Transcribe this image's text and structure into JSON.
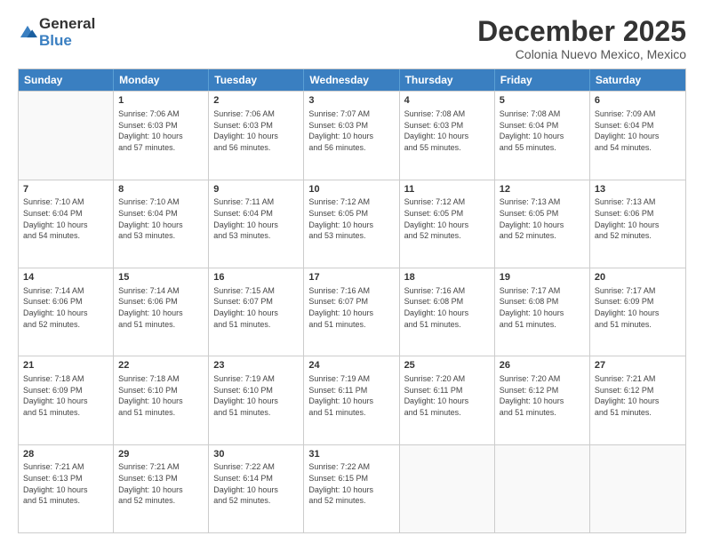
{
  "logo": {
    "general": "General",
    "blue": "Blue"
  },
  "title": "December 2025",
  "subtitle": "Colonia Nuevo Mexico, Mexico",
  "header_days": [
    "Sunday",
    "Monday",
    "Tuesday",
    "Wednesday",
    "Thursday",
    "Friday",
    "Saturday"
  ],
  "weeks": [
    [
      {
        "day": "",
        "info": ""
      },
      {
        "day": "1",
        "info": "Sunrise: 7:06 AM\nSunset: 6:03 PM\nDaylight: 10 hours\nand 57 minutes."
      },
      {
        "day": "2",
        "info": "Sunrise: 7:06 AM\nSunset: 6:03 PM\nDaylight: 10 hours\nand 56 minutes."
      },
      {
        "day": "3",
        "info": "Sunrise: 7:07 AM\nSunset: 6:03 PM\nDaylight: 10 hours\nand 56 minutes."
      },
      {
        "day": "4",
        "info": "Sunrise: 7:08 AM\nSunset: 6:03 PM\nDaylight: 10 hours\nand 55 minutes."
      },
      {
        "day": "5",
        "info": "Sunrise: 7:08 AM\nSunset: 6:04 PM\nDaylight: 10 hours\nand 55 minutes."
      },
      {
        "day": "6",
        "info": "Sunrise: 7:09 AM\nSunset: 6:04 PM\nDaylight: 10 hours\nand 54 minutes."
      }
    ],
    [
      {
        "day": "7",
        "info": "Sunrise: 7:10 AM\nSunset: 6:04 PM\nDaylight: 10 hours\nand 54 minutes."
      },
      {
        "day": "8",
        "info": "Sunrise: 7:10 AM\nSunset: 6:04 PM\nDaylight: 10 hours\nand 53 minutes."
      },
      {
        "day": "9",
        "info": "Sunrise: 7:11 AM\nSunset: 6:04 PM\nDaylight: 10 hours\nand 53 minutes."
      },
      {
        "day": "10",
        "info": "Sunrise: 7:12 AM\nSunset: 6:05 PM\nDaylight: 10 hours\nand 53 minutes."
      },
      {
        "day": "11",
        "info": "Sunrise: 7:12 AM\nSunset: 6:05 PM\nDaylight: 10 hours\nand 52 minutes."
      },
      {
        "day": "12",
        "info": "Sunrise: 7:13 AM\nSunset: 6:05 PM\nDaylight: 10 hours\nand 52 minutes."
      },
      {
        "day": "13",
        "info": "Sunrise: 7:13 AM\nSunset: 6:06 PM\nDaylight: 10 hours\nand 52 minutes."
      }
    ],
    [
      {
        "day": "14",
        "info": "Sunrise: 7:14 AM\nSunset: 6:06 PM\nDaylight: 10 hours\nand 52 minutes."
      },
      {
        "day": "15",
        "info": "Sunrise: 7:14 AM\nSunset: 6:06 PM\nDaylight: 10 hours\nand 51 minutes."
      },
      {
        "day": "16",
        "info": "Sunrise: 7:15 AM\nSunset: 6:07 PM\nDaylight: 10 hours\nand 51 minutes."
      },
      {
        "day": "17",
        "info": "Sunrise: 7:16 AM\nSunset: 6:07 PM\nDaylight: 10 hours\nand 51 minutes."
      },
      {
        "day": "18",
        "info": "Sunrise: 7:16 AM\nSunset: 6:08 PM\nDaylight: 10 hours\nand 51 minutes."
      },
      {
        "day": "19",
        "info": "Sunrise: 7:17 AM\nSunset: 6:08 PM\nDaylight: 10 hours\nand 51 minutes."
      },
      {
        "day": "20",
        "info": "Sunrise: 7:17 AM\nSunset: 6:09 PM\nDaylight: 10 hours\nand 51 minutes."
      }
    ],
    [
      {
        "day": "21",
        "info": "Sunrise: 7:18 AM\nSunset: 6:09 PM\nDaylight: 10 hours\nand 51 minutes."
      },
      {
        "day": "22",
        "info": "Sunrise: 7:18 AM\nSunset: 6:10 PM\nDaylight: 10 hours\nand 51 minutes."
      },
      {
        "day": "23",
        "info": "Sunrise: 7:19 AM\nSunset: 6:10 PM\nDaylight: 10 hours\nand 51 minutes."
      },
      {
        "day": "24",
        "info": "Sunrise: 7:19 AM\nSunset: 6:11 PM\nDaylight: 10 hours\nand 51 minutes."
      },
      {
        "day": "25",
        "info": "Sunrise: 7:20 AM\nSunset: 6:11 PM\nDaylight: 10 hours\nand 51 minutes."
      },
      {
        "day": "26",
        "info": "Sunrise: 7:20 AM\nSunset: 6:12 PM\nDaylight: 10 hours\nand 51 minutes."
      },
      {
        "day": "27",
        "info": "Sunrise: 7:21 AM\nSunset: 6:12 PM\nDaylight: 10 hours\nand 51 minutes."
      }
    ],
    [
      {
        "day": "28",
        "info": "Sunrise: 7:21 AM\nSunset: 6:13 PM\nDaylight: 10 hours\nand 51 minutes."
      },
      {
        "day": "29",
        "info": "Sunrise: 7:21 AM\nSunset: 6:13 PM\nDaylight: 10 hours\nand 52 minutes."
      },
      {
        "day": "30",
        "info": "Sunrise: 7:22 AM\nSunset: 6:14 PM\nDaylight: 10 hours\nand 52 minutes."
      },
      {
        "day": "31",
        "info": "Sunrise: 7:22 AM\nSunset: 6:15 PM\nDaylight: 10 hours\nand 52 minutes."
      },
      {
        "day": "",
        "info": ""
      },
      {
        "day": "",
        "info": ""
      },
      {
        "day": "",
        "info": ""
      }
    ]
  ]
}
